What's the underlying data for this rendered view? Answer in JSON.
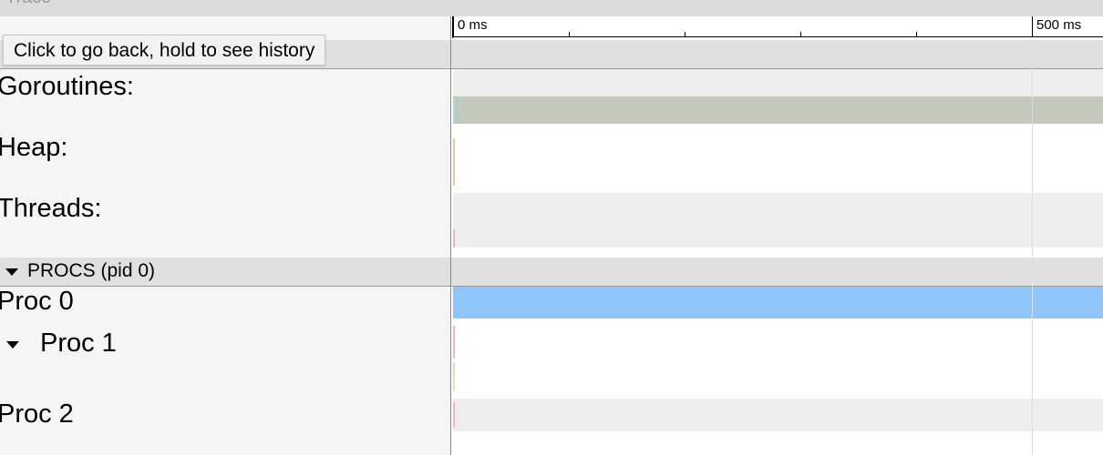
{
  "window": {
    "title": "Trace"
  },
  "ruler": {
    "ticks": [
      {
        "label": "0 ms"
      },
      {
        "label": "500 ms"
      }
    ]
  },
  "tooltip": {
    "text": "Click to go back, hold to see history"
  },
  "counters": {
    "goroutines_label": "Goroutines:",
    "heap_label": "Heap:",
    "threads_label": "Threads:"
  },
  "procs": {
    "section_title": "PROCS (pid 0)",
    "items": [
      {
        "label": "Proc 0"
      },
      {
        "label": "Proc 1"
      },
      {
        "label": "Proc 2"
      }
    ]
  },
  "colors": {
    "goroutines_bar": "#c2c9bb",
    "proc0_bar": "#8ec6fb",
    "heap_mark": "#e8c9a8",
    "threads_mark": "#e9b5d3",
    "proc_mark": "#f4b6c2",
    "band_gray": "#eeeeee"
  }
}
